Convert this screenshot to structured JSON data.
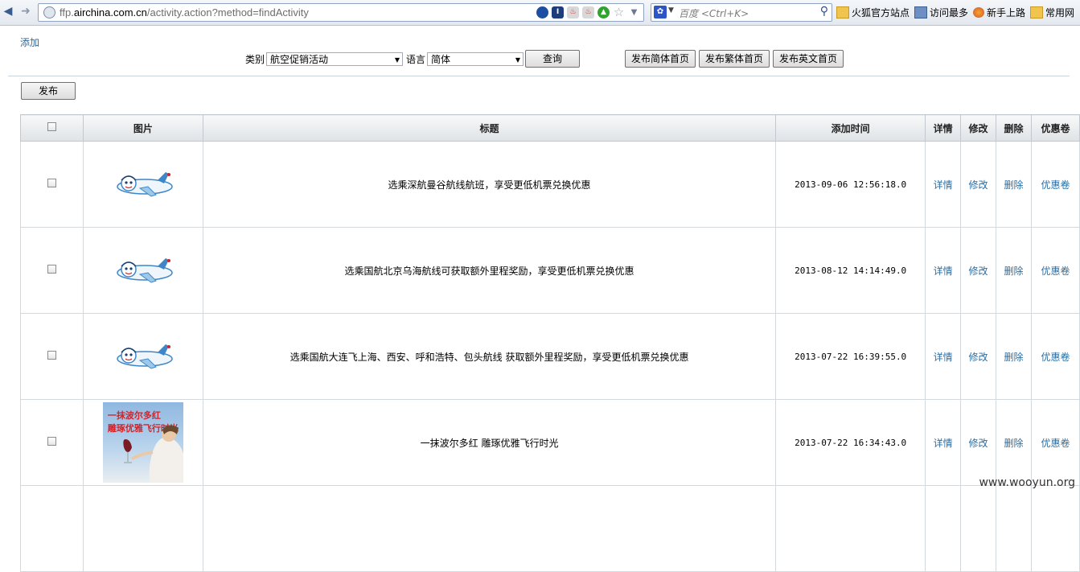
{
  "browser": {
    "url_prefix": "ffp.",
    "url_host": "airchina.com.cn",
    "url_path": "/activity.action?method=findActivity",
    "search_placeholder": "百度 <Ctrl+K>",
    "bookmarks": [
      {
        "label": "火狐官方站点"
      },
      {
        "label": "访问最多"
      },
      {
        "label": "新手上路"
      },
      {
        "label": "常用网"
      }
    ]
  },
  "page": {
    "add_link": "添加",
    "filter": {
      "category_label": "类别",
      "category_value": "航空促销活动",
      "language_label": "语言",
      "language_value": "简体",
      "query_button": "查询"
    },
    "publish_buttons": {
      "simplified": "发布简体首页",
      "traditional": "发布繁体首页",
      "english": "发布英文首页"
    },
    "publish_button": "发布"
  },
  "table": {
    "headers": {
      "image": "图片",
      "title": "标题",
      "added_time": "添加时间",
      "details": "详情",
      "edit": "修改",
      "delete": "删除",
      "coupon": "优惠卷"
    },
    "rows": [
      {
        "title": "选乘深航曼谷航线航班，享受更低机票兑换优惠",
        "time": "2013-09-06 12:56:18.0",
        "details": "详情",
        "edit": "修改",
        "delete": "删除",
        "coupon": "优惠卷"
      },
      {
        "title": "选乘国航北京乌海航线可获取额外里程奖励，享受更低机票兑换优惠",
        "time": "2013-08-12 14:14:49.0",
        "details": "详情",
        "edit": "修改",
        "delete": "删除",
        "coupon": "优惠卷"
      },
      {
        "title": "选乘国航大连飞上海、西安、呼和浩特、包头航线 获取额外里程奖励，享受更低机票兑换优惠",
        "time": "2013-07-22 16:39:55.0",
        "details": "详情",
        "edit": "修改",
        "delete": "删除",
        "coupon": "优惠卷"
      },
      {
        "title": "一抹波尔多红 雕琢优雅飞行时光",
        "time": "2013-07-22 16:34:43.0",
        "details": "详情",
        "edit": "修改",
        "delete": "删除",
        "coupon": "优惠卷"
      }
    ],
    "poster": {
      "line1": "一抹波尔多红",
      "line2": "雕琢优雅飞行时光"
    }
  },
  "watermark": "www.wooyun.org",
  "colors": {
    "link": "#2d6da0",
    "header_bg": "#dfe3e6",
    "poster_text": "#d2232a"
  }
}
